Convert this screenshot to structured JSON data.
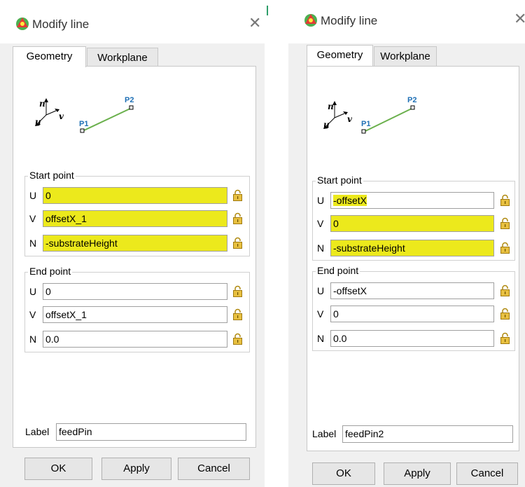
{
  "dialogs": [
    {
      "title": "Modify line",
      "tabs": [
        "Geometry",
        "Workplane"
      ],
      "diagram": {
        "n": "n",
        "u": "u",
        "v": "v",
        "p1": "P1",
        "p2": "P2"
      },
      "start_point": {
        "legend": "Start point",
        "rows": [
          {
            "axis": "U",
            "value": "0"
          },
          {
            "axis": "V",
            "value": "offsetX_1"
          },
          {
            "axis": "N",
            "value": "-substrateHeight"
          }
        ]
      },
      "end_point": {
        "legend": "End point",
        "rows": [
          {
            "axis": "U",
            "value": "0"
          },
          {
            "axis": "V",
            "value": "offsetX_1"
          },
          {
            "axis": "N",
            "value": "0.0"
          }
        ]
      },
      "label": {
        "caption": "Label",
        "value": "feedPin"
      },
      "buttons": {
        "ok": "OK",
        "apply": "Apply",
        "cancel": "Cancel"
      }
    },
    {
      "title": "Modify line",
      "tabs": [
        "Geometry",
        "Workplane"
      ],
      "diagram": {
        "n": "n",
        "u": "u",
        "v": "v",
        "p1": "P1",
        "p2": "P2"
      },
      "start_point": {
        "legend": "Start point",
        "rows": [
          {
            "axis": "U",
            "value": "-offsetX"
          },
          {
            "axis": "V",
            "value": "0"
          },
          {
            "axis": "N",
            "value": "-substrateHeight"
          }
        ]
      },
      "end_point": {
        "legend": "End point",
        "rows": [
          {
            "axis": "U",
            "value": "-offsetX"
          },
          {
            "axis": "V",
            "value": "0"
          },
          {
            "axis": "N",
            "value": "0.0"
          }
        ]
      },
      "label": {
        "caption": "Label",
        "value": "feedPin2"
      },
      "buttons": {
        "ok": "OK",
        "apply": "Apply",
        "cancel": "Cancel"
      }
    }
  ],
  "colors": {
    "highlight": "#ece91c",
    "line": "#6ab04c",
    "point_label": "#1e6fb5",
    "lock": "#e0b020"
  },
  "icons": [
    "app-icon",
    "close-icon",
    "lock-icon",
    "coordinate-axes-icon"
  ]
}
